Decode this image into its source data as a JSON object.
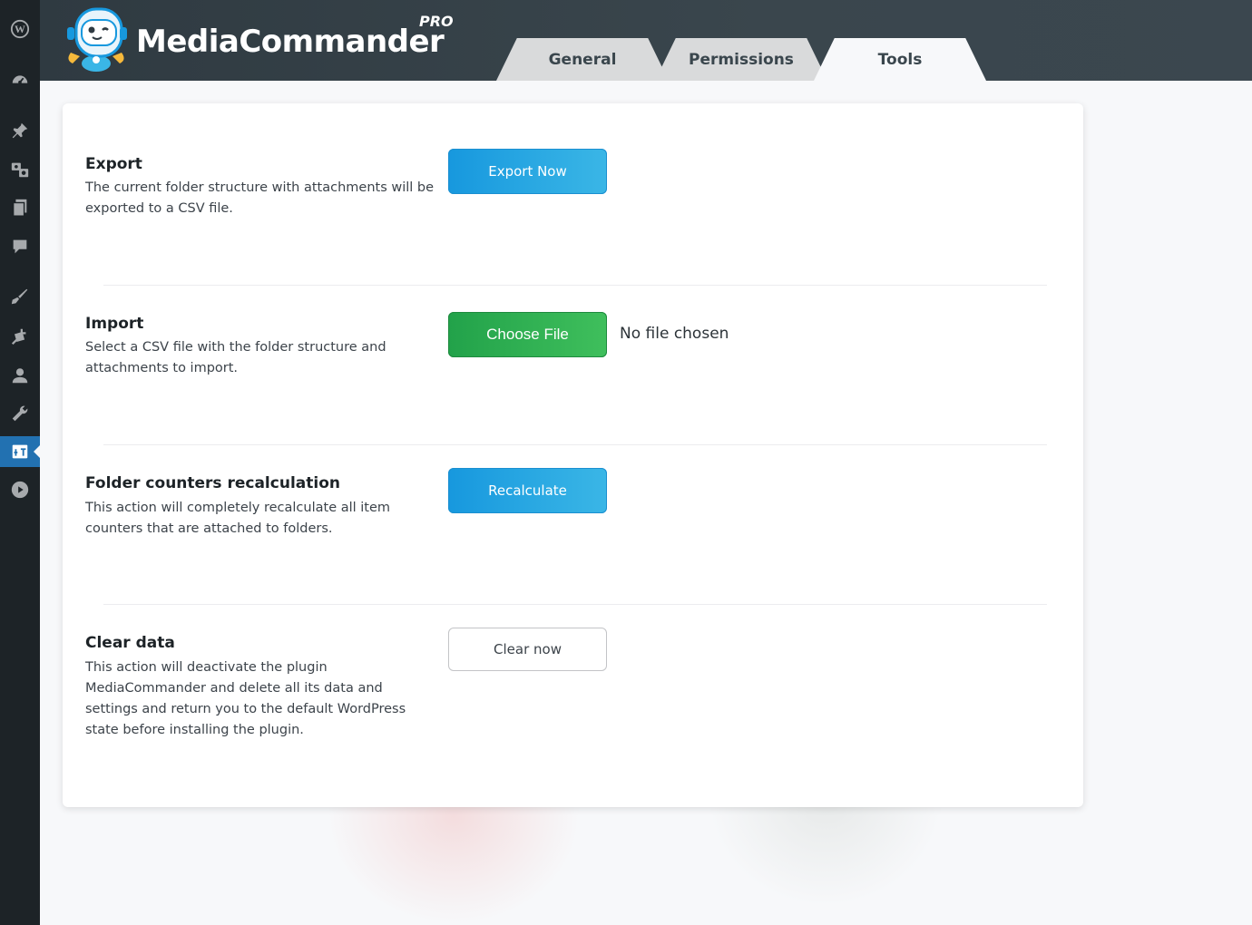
{
  "sidebar": {
    "icons": [
      "wordpress-icon",
      "dashboard-icon",
      "posts-icon",
      "media-icon",
      "pages-icon",
      "comments-icon",
      "appearance-icon",
      "plugins-icon",
      "users-icon",
      "tools-icon",
      "mediacommander-icon",
      "play-icon"
    ]
  },
  "header": {
    "brand": "MediaCommander",
    "badge": "PRO",
    "tabs": [
      {
        "label": "General",
        "active": false
      },
      {
        "label": "Permissions",
        "active": false
      },
      {
        "label": "Tools",
        "active": true
      }
    ]
  },
  "sections": {
    "export": {
      "title": "Export",
      "description": "The current folder structure with attachments will be exported to a CSV file.",
      "button": "Export Now"
    },
    "import": {
      "title": "Import",
      "description": "Select a CSV file with the folder structure and attachments to import.",
      "button": "Choose File",
      "file_status": "No file chosen"
    },
    "recalculate": {
      "title": "Folder counters recalculation",
      "description": "This action will completely recalculate all item counters that are attached to folders.",
      "button": "Recalculate"
    },
    "clear": {
      "title": "Clear data",
      "description": "This action will deactivate the plugin MediaCommander and delete all its data and settings and return you to the default WordPress state before installing the plugin.",
      "button": "Clear now"
    }
  },
  "colors": {
    "primary_blue": "#1798de",
    "success_green": "#22a24a",
    "header_bg": "#2f3a41",
    "wp_sidebar": "#1d2327",
    "wp_active": "#2271b1"
  }
}
